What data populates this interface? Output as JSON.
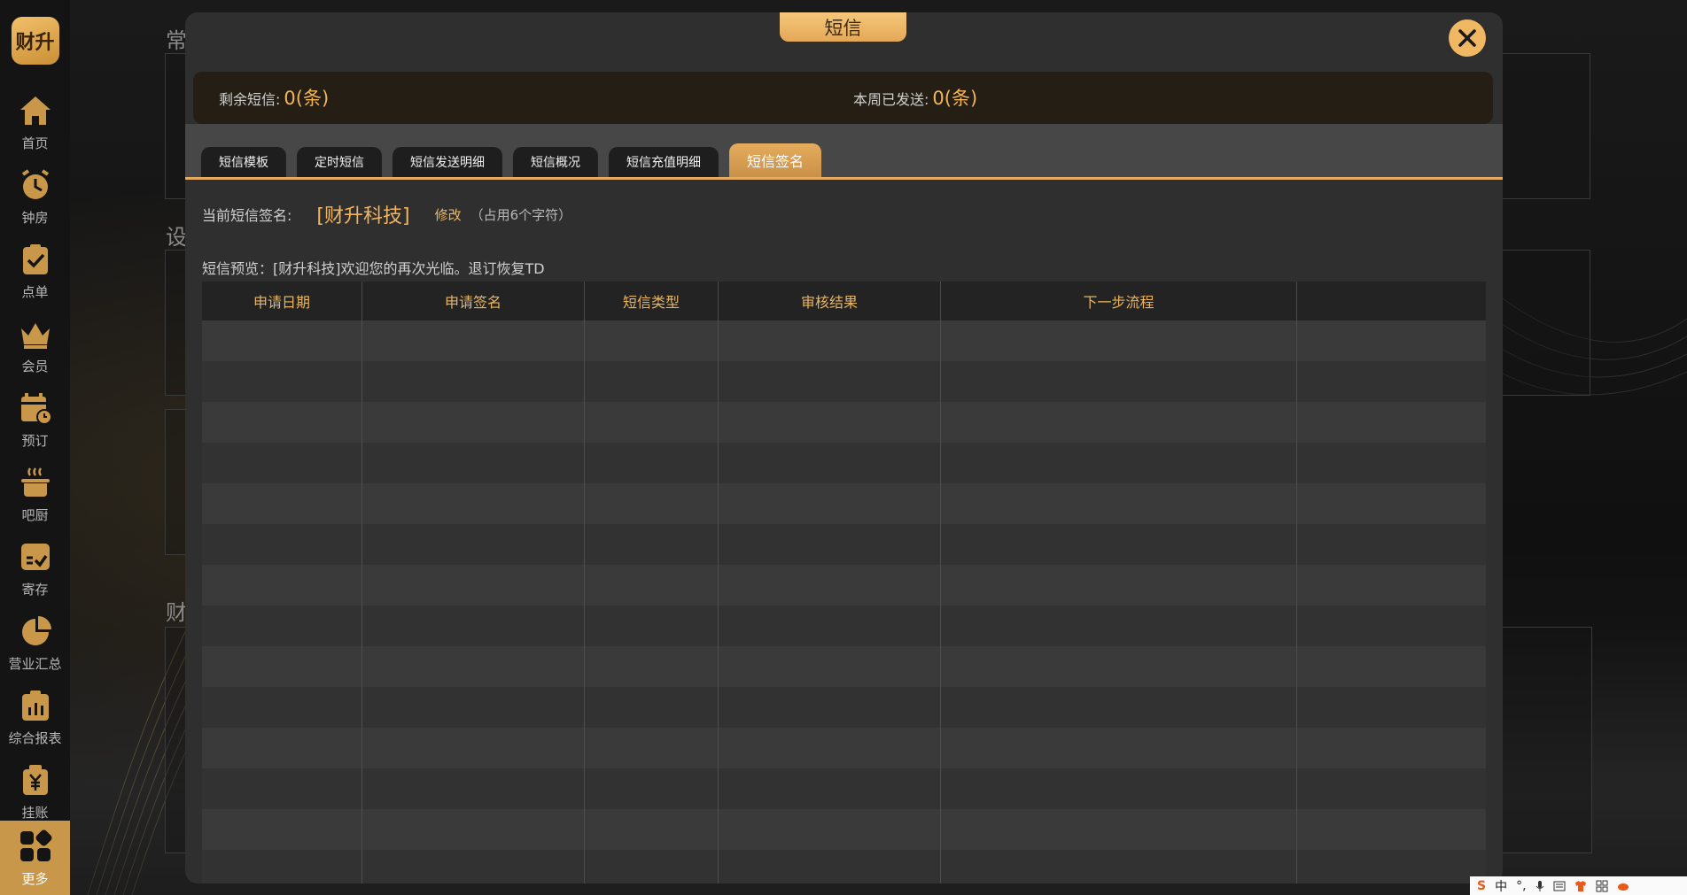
{
  "background": {
    "headings": [
      "常",
      "设",
      "财"
    ]
  },
  "sidebar": {
    "logo_text": "财升",
    "items": [
      {
        "label": "首页",
        "icon": "home-icon"
      },
      {
        "label": "钟房",
        "icon": "clock-icon"
      },
      {
        "label": "点单",
        "icon": "clipboard-check-icon"
      },
      {
        "label": "会员",
        "icon": "crown-icon"
      },
      {
        "label": "预订",
        "icon": "calendar-clock-icon"
      },
      {
        "label": "吧厨",
        "icon": "pot-icon"
      },
      {
        "label": "寄存",
        "icon": "storage-box-icon"
      },
      {
        "label": "营业汇总",
        "icon": "pie-chart-icon"
      },
      {
        "label": "综合报表",
        "icon": "bar-report-icon"
      },
      {
        "label": "挂账",
        "icon": "yen-bag-icon"
      },
      {
        "label": "更多",
        "icon": "grid-more-icon"
      }
    ],
    "active": "更多"
  },
  "modal": {
    "title": "短信",
    "stats": {
      "remaining_label": "剩余短信:",
      "remaining_value": "0(条)",
      "week_label": "本周已发送:",
      "week_value": "0(条)"
    },
    "tabs": [
      "短信模板",
      "定时短信",
      "短信发送明细",
      "短信概况",
      "短信充值明细",
      "短信签名"
    ],
    "active_tab": "短信签名",
    "signature": {
      "label": "当前短信签名:",
      "value": "[财升科技]",
      "edit": "修改",
      "note": "（占用6个字符）"
    },
    "preview": "短信预览：[财升科技]欢迎您的再次光临。退订恢复TD",
    "table": {
      "columns": [
        "申请日期",
        "申请签名",
        "短信类型",
        "审核结果",
        "下一步流程",
        ""
      ],
      "rows": []
    }
  },
  "colors": {
    "accent": "#f2b45c",
    "tab_active": "#e6ac5c",
    "modal_bg": "#2f2f2f"
  },
  "tray": {
    "items": [
      "中",
      "°,"
    ]
  }
}
